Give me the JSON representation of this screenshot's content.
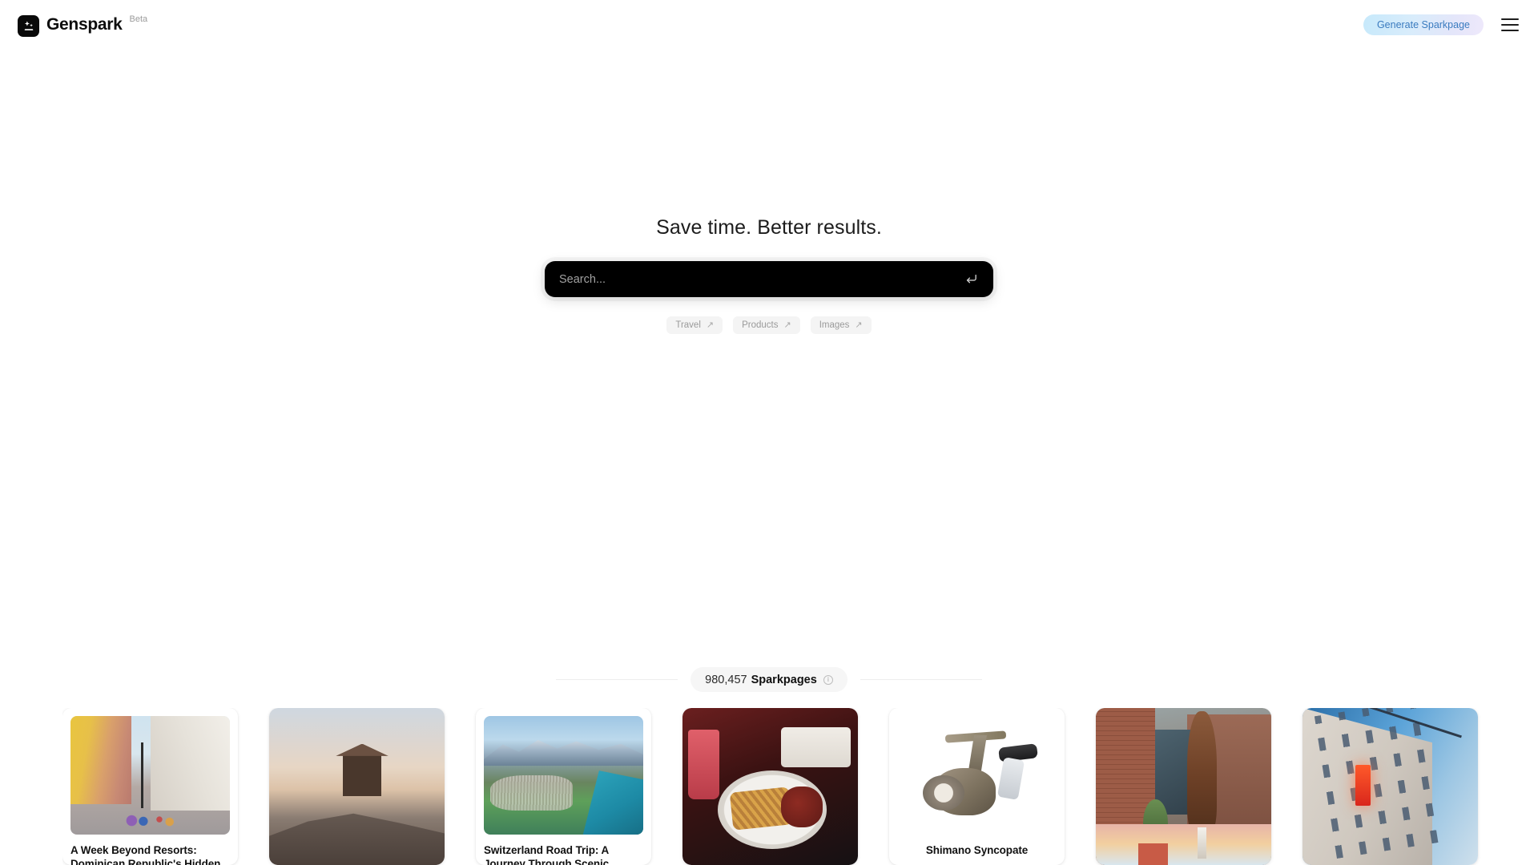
{
  "header": {
    "logo_icon": "sparkle-logo-icon",
    "brand_name": "Genspark",
    "beta_label": "Beta",
    "generate_button": "Generate Sparkpage",
    "menu_icon": "hamburger-menu-icon",
    "accent_text_color": "#3a7bbf"
  },
  "hero": {
    "tagline": "Save time. Better results.",
    "search": {
      "placeholder": "Search...",
      "value": "",
      "submit_icon": "enter-return-icon"
    },
    "chips": [
      {
        "label": "Travel",
        "arrow": "↗"
      },
      {
        "label": "Products",
        "arrow": "↗"
      },
      {
        "label": "Images",
        "arrow": "↗"
      }
    ]
  },
  "counter": {
    "count": "980,457",
    "word": "Sparkpages",
    "info_icon": "info-icon",
    "info_glyph": "i"
  },
  "cards": [
    {
      "title": "A Week Beyond Resorts: Dominican Republic's Hidden",
      "thumb": "colonial-street-scene"
    },
    {
      "title": "",
      "thumb": "desert-mountain-watchtower"
    },
    {
      "title": "Switzerland Road Trip: A Journey Through Scenic",
      "thumb": "swiss-alpine-lake"
    },
    {
      "title": "",
      "thumb": "restaurant-food-plate"
    },
    {
      "title": "Shimano Syncopate",
      "thumb": "shimano-fishing-reel"
    },
    {
      "title": "",
      "thumb": "brick-building-bear-sculpture"
    },
    {
      "title": "",
      "thumb": "hotel-facade-red-sign"
    }
  ]
}
